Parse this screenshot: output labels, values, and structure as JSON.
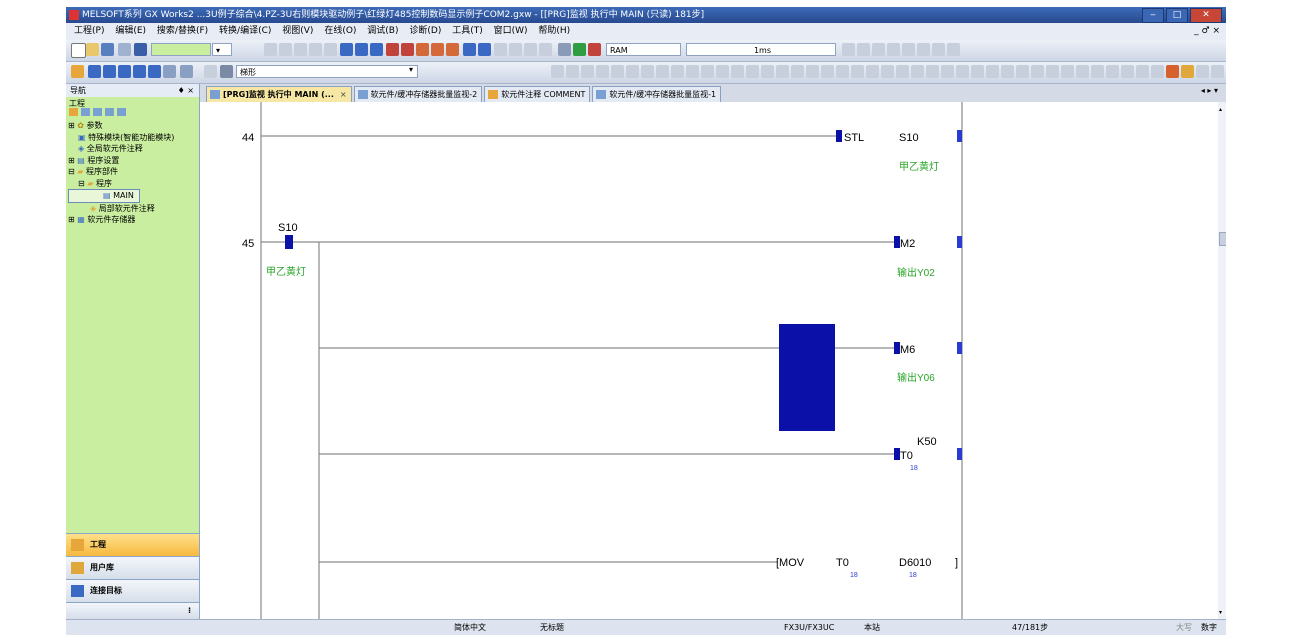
{
  "window": {
    "title": "MELSOFT系列 GX Works2 ...3U例子综合\\4.PZ-3U右则模块驱动例子\\红绿灯485控制数码显示例子COM2.gxw - [[PRG]监视 执行中 MAIN (只读) 181步]",
    "mdi_controls": "_ ♂ ×"
  },
  "menu": {
    "items": [
      "工程(P)",
      "编辑(E)",
      "搜索/替换(F)",
      "转换/编译(C)",
      "视图(V)",
      "在线(O)",
      "调试(B)",
      "诊断(D)",
      "工具(T)",
      "窗口(W)",
      "帮助(H)"
    ]
  },
  "toolbar": {
    "memory_value": "RAM",
    "interval_value": "1ms",
    "search_value": "梯形"
  },
  "navigation": {
    "title": "导航",
    "pin": "♦ ×",
    "section": "工程",
    "tree": [
      "参数",
      "特殊模块(智能功能模块)",
      "全局软元件注释",
      "程序设置",
      "程序部件",
      "程序",
      "MAIN",
      "局部软元件注释",
      "软元件存储器"
    ],
    "buttons": [
      "工程",
      "用户库",
      "连接目标"
    ],
    "more": "⁝"
  },
  "tabs": [
    {
      "label": "[PRG]监视 执行中 MAIN (...",
      "close": "×"
    },
    {
      "label": "软元件/缓冲存储器批量监视-2"
    },
    {
      "label": "软元件注释 COMMENT"
    },
    {
      "label": "软元件/缓冲存储器批量监视-1"
    }
  ],
  "tab_nav": "◂ ▸ ▾",
  "ladder": {
    "rung_44": {
      "step": "44",
      "instruction": "STL",
      "device": "S10",
      "comment": "甲乙黄灯"
    },
    "rung_45": {
      "step": "45",
      "contact_device": "S10",
      "contact_comment": "甲乙黄灯",
      "coil_1_device": "M2",
      "coil_1_comment": "输出Y02",
      "coil_2_device": "M6",
      "coil_2_comment": "输出Y06",
      "timer_device": "T0",
      "timer_setpoint": "K50",
      "timer_current": "18",
      "mov_instruction": "[MOV",
      "mov_source": "T0",
      "mov_source_value": "18",
      "mov_dest": "D6010",
      "mov_dest_value": "18",
      "mov_close": "]"
    }
  },
  "status": {
    "language": "简体中文",
    "title": "无标题",
    "plc": "FX3U/FX3UC",
    "station": "本站",
    "steps": "47/181步",
    "caps": "大写",
    "num": "数字"
  },
  "colors": {
    "title_bar": "#2d58a6",
    "navigator_bg": "#c9ee9f",
    "contact_blue": "#0a10a8",
    "comment_green": "#2aa52a",
    "active_tab": "#f7e7a5"
  }
}
